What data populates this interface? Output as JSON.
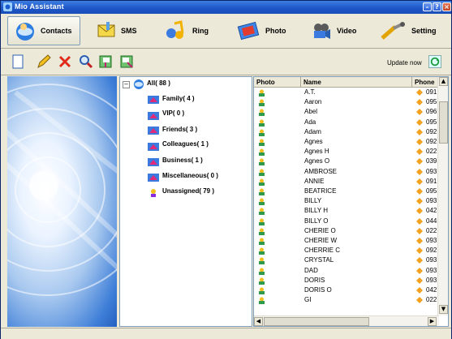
{
  "window": {
    "title": "Mio Assistant"
  },
  "tabs": [
    {
      "label": "Contacts",
      "icon": "contacts-icon",
      "active": true
    },
    {
      "label": "SMS",
      "icon": "sms-icon"
    },
    {
      "label": "Ring",
      "icon": "ring-icon"
    },
    {
      "label": "Photo",
      "icon": "photo-icon"
    },
    {
      "label": "Video",
      "icon": "video-icon"
    },
    {
      "label": "Setting",
      "icon": "setting-icon"
    }
  ],
  "toolbar": {
    "update_label": "Update now",
    "tools": [
      "new-contact-icon",
      "edit-contact-icon",
      "delete-contact-icon",
      "search-contacts-icon",
      "import-contacts-icon",
      "export-contacts-icon"
    ]
  },
  "tree": {
    "root": "All( 88 )",
    "groups": [
      "Family( 4 )",
      "VIP( 0 )",
      "Friends( 3 )",
      "Colleagues( 1 )",
      "Business( 1 )",
      "Miscellaneous( 0 )",
      "Unassigned( 79 )"
    ]
  },
  "table": {
    "headers": [
      "Photo",
      "Name",
      "Phone"
    ],
    "rows": [
      {
        "name": "A.T.",
        "phone": "091"
      },
      {
        "name": "Aaron",
        "phone": "095"
      },
      {
        "name": "Abel",
        "phone": "096"
      },
      {
        "name": "Ada",
        "phone": "095"
      },
      {
        "name": "Adam",
        "phone": "092"
      },
      {
        "name": "Agnes",
        "phone": "092"
      },
      {
        "name": "Agnes H",
        "phone": "022"
      },
      {
        "name": "Agnes O",
        "phone": "039"
      },
      {
        "name": "AMBROSE",
        "phone": "093"
      },
      {
        "name": "ANNIE",
        "phone": "091"
      },
      {
        "name": "BEATRICE",
        "phone": "095"
      },
      {
        "name": "BILLY",
        "phone": "093"
      },
      {
        "name": "BILLY H",
        "phone": "042"
      },
      {
        "name": "BILLY O",
        "phone": "044"
      },
      {
        "name": "CHERIE O",
        "phone": "022"
      },
      {
        "name": "CHERIE W",
        "phone": "093"
      },
      {
        "name": "CHERRIE C",
        "phone": "092"
      },
      {
        "name": "CRYSTAL",
        "phone": "093"
      },
      {
        "name": "DAD",
        "phone": "093"
      },
      {
        "name": "DORIS",
        "phone": "093"
      },
      {
        "name": "DORIS O",
        "phone": "042"
      },
      {
        "name": "GI",
        "phone": "022"
      }
    ]
  }
}
